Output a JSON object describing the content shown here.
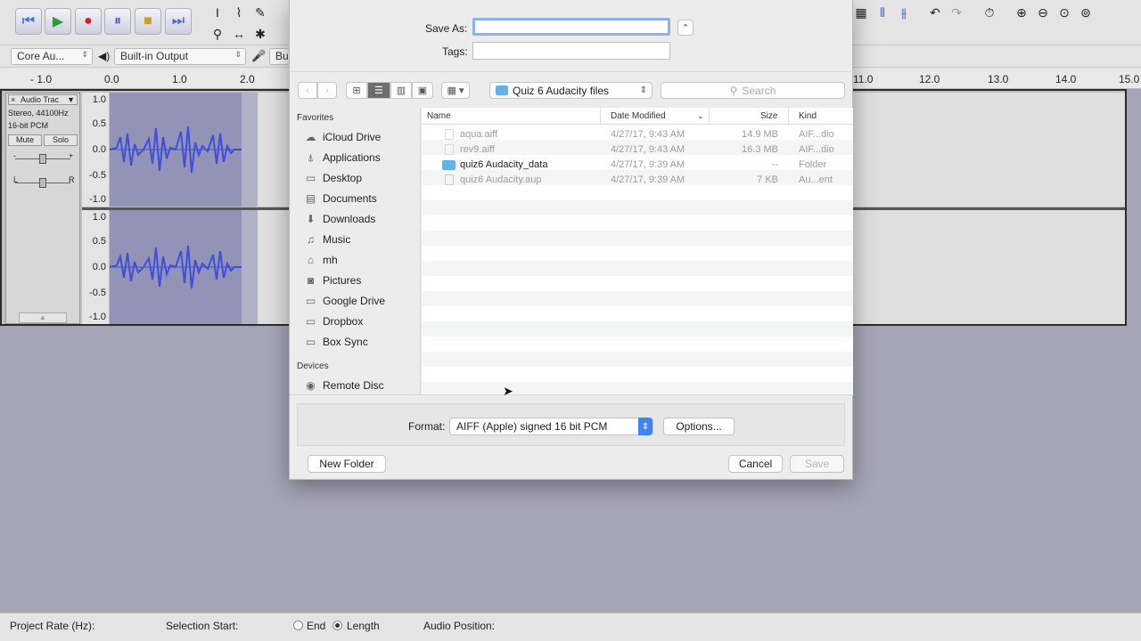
{
  "audacity": {
    "devices": {
      "host": "Core Au...",
      "output": "Built-in Output",
      "input_partial": "Bui"
    },
    "ruler": [
      "- 1.0",
      "0.0",
      "1.0",
      "2.0",
      "11.0",
      "12.0",
      "13.0",
      "14.0",
      "15.0"
    ],
    "track": {
      "name": "Audio Trac",
      "info1": "Stereo, 44100Hz",
      "info2": "16-bit PCM",
      "mute": "Mute",
      "solo": "Solo",
      "close": "×",
      "menu": "▼",
      "gain_minus": "-",
      "gain_plus": "+",
      "pan_l": "L",
      "pan_r": "R",
      "scale": [
        "1.0",
        "0.5",
        "0.0",
        "-0.5",
        "-1.0"
      ]
    },
    "status": {
      "project_rate_label": "Project Rate (Hz):",
      "selection_start_label": "Selection Start:",
      "end_label": "End",
      "length_label": "Length",
      "audio_position_label": "Audio Position:"
    }
  },
  "dialog": {
    "save_as_label": "Save As:",
    "save_as_value": "",
    "tags_label": "Tags:",
    "tags_value": "",
    "expand": "⌃",
    "location": "Quiz 6 Audacity files",
    "search_placeholder": "Search",
    "sidebar": {
      "favorites_label": "Favorites",
      "favorites": [
        {
          "label": "iCloud Drive",
          "icon": "☁"
        },
        {
          "label": "Applications",
          "icon": "⍋"
        },
        {
          "label": "Desktop",
          "icon": "▭"
        },
        {
          "label": "Documents",
          "icon": "▤"
        },
        {
          "label": "Downloads",
          "icon": "⬇"
        },
        {
          "label": "Music",
          "icon": "♫"
        },
        {
          "label": "mh",
          "icon": "⌂"
        },
        {
          "label": "Pictures",
          "icon": "◙"
        },
        {
          "label": "Google Drive",
          "icon": "▭"
        },
        {
          "label": "Dropbox",
          "icon": "▭"
        },
        {
          "label": "Box Sync",
          "icon": "▭"
        }
      ],
      "devices_label": "Devices",
      "devices": [
        {
          "label": "Remote Disc",
          "icon": "◉"
        }
      ]
    },
    "columns": {
      "name": "Name",
      "date": "Date Modified",
      "size": "Size",
      "kind": "Kind"
    },
    "files": [
      {
        "name": "aqua.aiff",
        "date": "4/27/17, 9:43 AM",
        "size": "14.9 MB",
        "kind": "AIF...dio",
        "enabled": false
      },
      {
        "name": "rev9.aiff",
        "date": "4/27/17, 9:43 AM",
        "size": "16.3 MB",
        "kind": "AIF...dio",
        "enabled": false
      },
      {
        "name": "quiz6 Audacity_data",
        "date": "4/27/17, 9:39 AM",
        "size": "--",
        "kind": "Folder",
        "enabled": true
      },
      {
        "name": "quiz6 Audacity.aup",
        "date": "4/27/17, 9:39 AM",
        "size": "7 KB",
        "kind": "Au...ent",
        "enabled": false
      }
    ],
    "format_label": "Format:",
    "format_value": "AIFF (Apple) signed 16 bit PCM",
    "options_label": "Options...",
    "new_folder_label": "New Folder",
    "cancel_label": "Cancel",
    "save_label": "Save"
  }
}
